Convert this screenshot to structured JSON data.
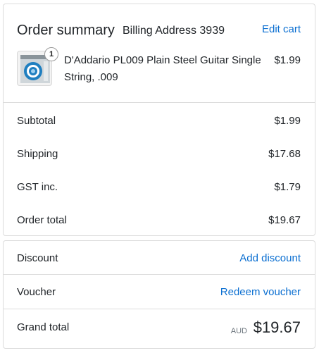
{
  "summary": {
    "title": "Order summary",
    "subtitle": "Billing Address 3939",
    "edit_cart": "Edit cart"
  },
  "product": {
    "quantity": "1",
    "name": "D'Addario PL009 Plain Steel Guitar Single String, .009",
    "price": "$1.99",
    "thumb_icon": "string-packet-icon"
  },
  "totals": {
    "subtotal_label": "Subtotal",
    "subtotal_value": "$1.99",
    "shipping_label": "Shipping",
    "shipping_value": "$17.68",
    "gst_label": "GST inc.",
    "gst_value": "$1.79",
    "order_total_label": "Order total",
    "order_total_value": "$19.67"
  },
  "discount": {
    "label": "Discount",
    "link": "Add discount"
  },
  "voucher": {
    "label": "Voucher",
    "link": "Redeem voucher"
  },
  "grand_total": {
    "label": "Grand total",
    "currency": "AUD",
    "value": "$19.67"
  },
  "colors": {
    "link": "#0b6fd1",
    "border": "#dcdcdc",
    "text": "#212529"
  }
}
